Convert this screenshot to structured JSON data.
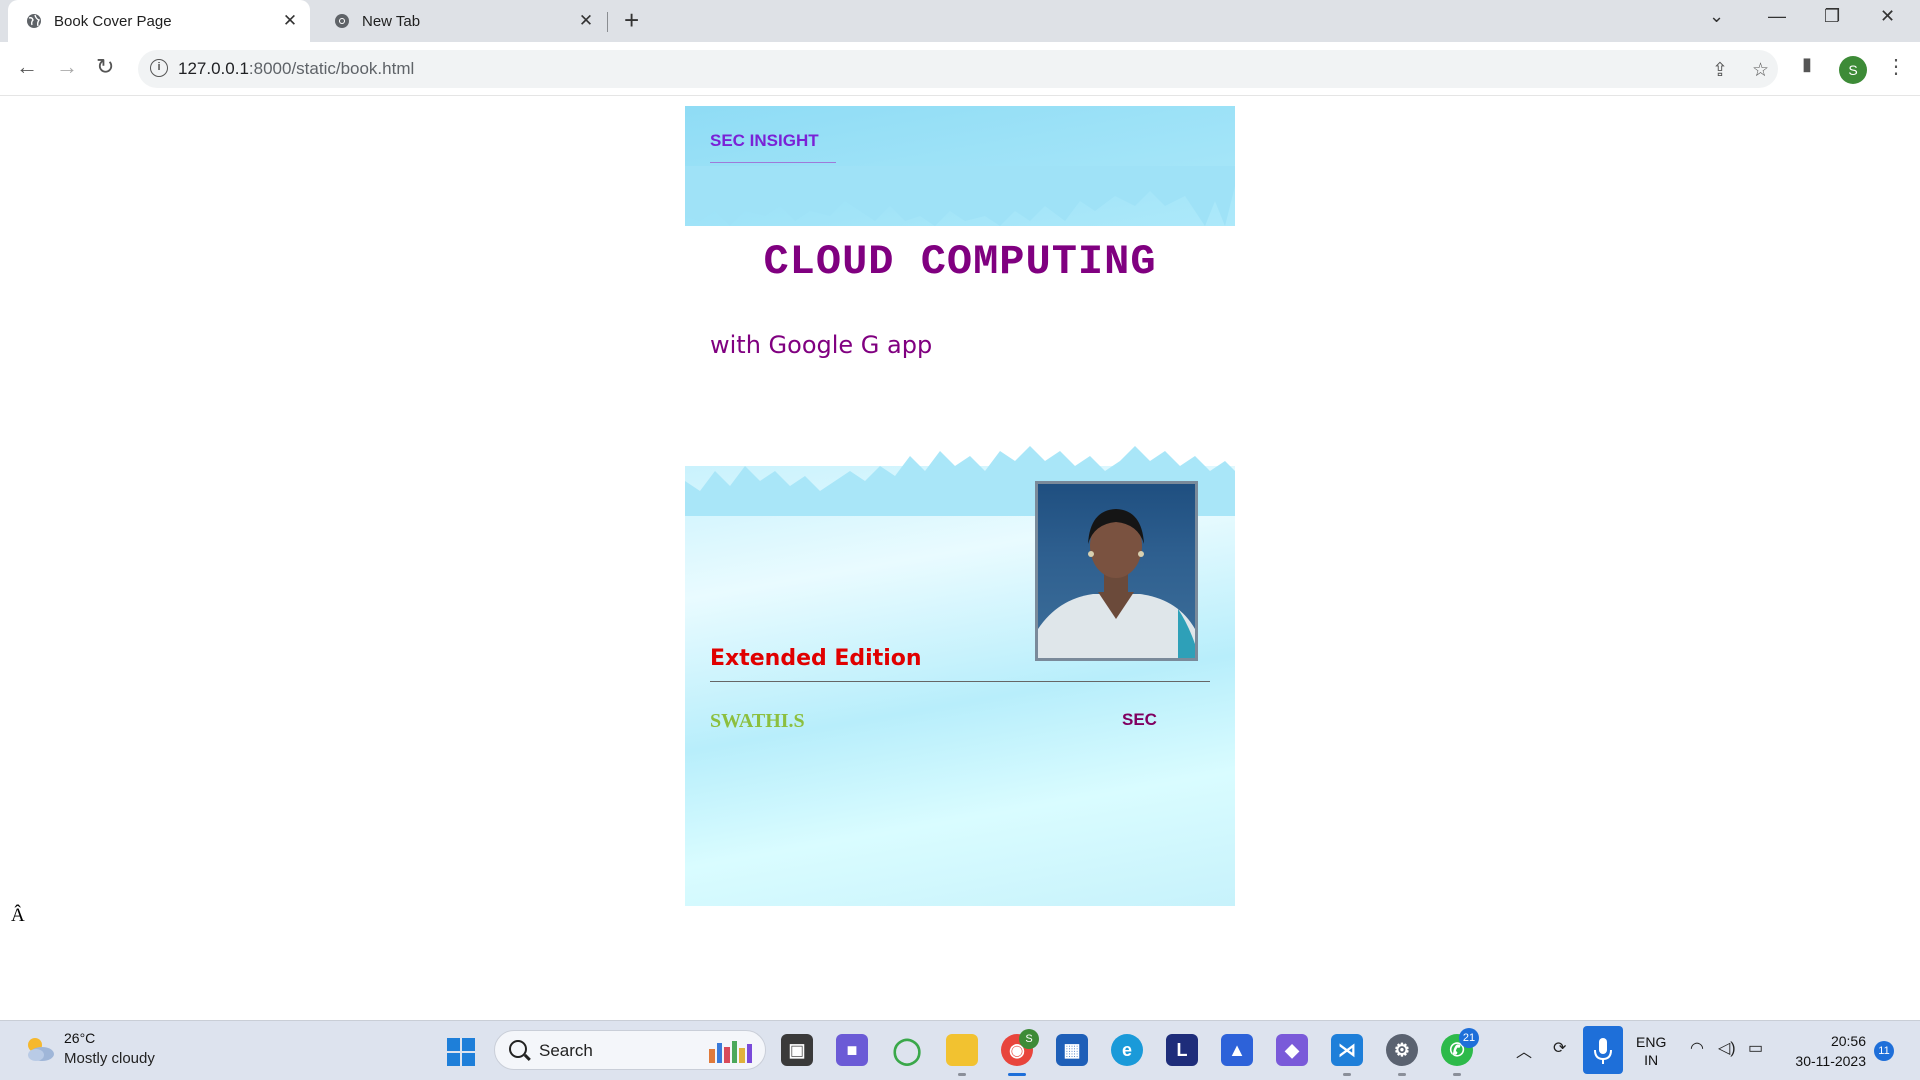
{
  "browser": {
    "tabs": [
      {
        "title": "Book Cover Page",
        "active": true
      },
      {
        "title": "New Tab",
        "active": false
      }
    ],
    "url_host": "127.0.0.1",
    "url_rest": ":8000/static/book.html",
    "profile_initial": "S"
  },
  "book": {
    "series": "SEC INSIGHT",
    "title": "CLOUD COMPUTING",
    "subtitle": "with Google G app",
    "edition": "Extended Edition",
    "author": "SWATHI.S",
    "publisher": "SEC"
  },
  "page": {
    "stray_char": "Â"
  },
  "taskbar": {
    "temperature": "26°C",
    "condition": "Mostly cloudy",
    "search_label": "Search",
    "whatsapp_badge": "21",
    "chrome_badge": "S",
    "lang_line1": "ENG",
    "lang_line2": "IN",
    "time": "20:56",
    "date": "30-11-2023",
    "notifications": "11"
  },
  "colors": {
    "title": "#800080",
    "series": "#7a22d6",
    "edition": "#e00000",
    "author": "#8cbf3f",
    "accent": "#1e6fd9"
  }
}
